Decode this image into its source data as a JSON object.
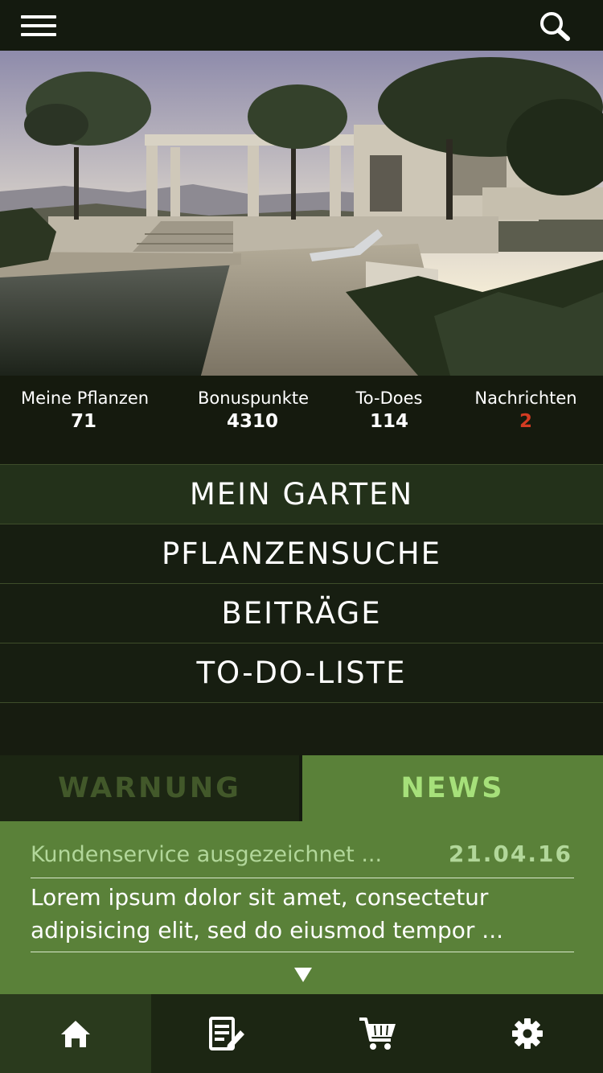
{
  "topbar": {
    "menu_icon": "hamburger-menu-icon",
    "search_icon": "search-icon"
  },
  "hero": {
    "image": "garden-terrace-photo"
  },
  "stats": [
    {
      "label": "Meine Pflanzen",
      "value": "71"
    },
    {
      "label": "Bonuspunkte",
      "value": "4310"
    },
    {
      "label": "To-Does",
      "value": "114"
    },
    {
      "label": "Nachrichten",
      "value": "2"
    }
  ],
  "menu": [
    {
      "label": "MEIN GARTEN"
    },
    {
      "label": "PFLANZENSUCHE"
    },
    {
      "label": "BEITRÄGE"
    },
    {
      "label": "TO-DO-LISTE"
    }
  ],
  "tabs": {
    "warnung": "WARNUNG",
    "news": "NEWS"
  },
  "news_item": {
    "title": "Kundenservice ausgezeichnet ...",
    "date": "21.04.16",
    "body": "Lorem ipsum dolor sit amet, consectetur adipisicing elit, sed do eiusmod tempor ...",
    "more_icon": "triangle-down-icon"
  },
  "bottom_nav": [
    {
      "icon": "home-icon"
    },
    {
      "icon": "edit-note-icon"
    },
    {
      "icon": "shopping-cart-icon"
    },
    {
      "icon": "gear-icon"
    }
  ],
  "colors": {
    "background": "#171c10",
    "accent_green": "#5a8139",
    "alert_red": "#d33b22",
    "news_text": "#b2d79a"
  }
}
